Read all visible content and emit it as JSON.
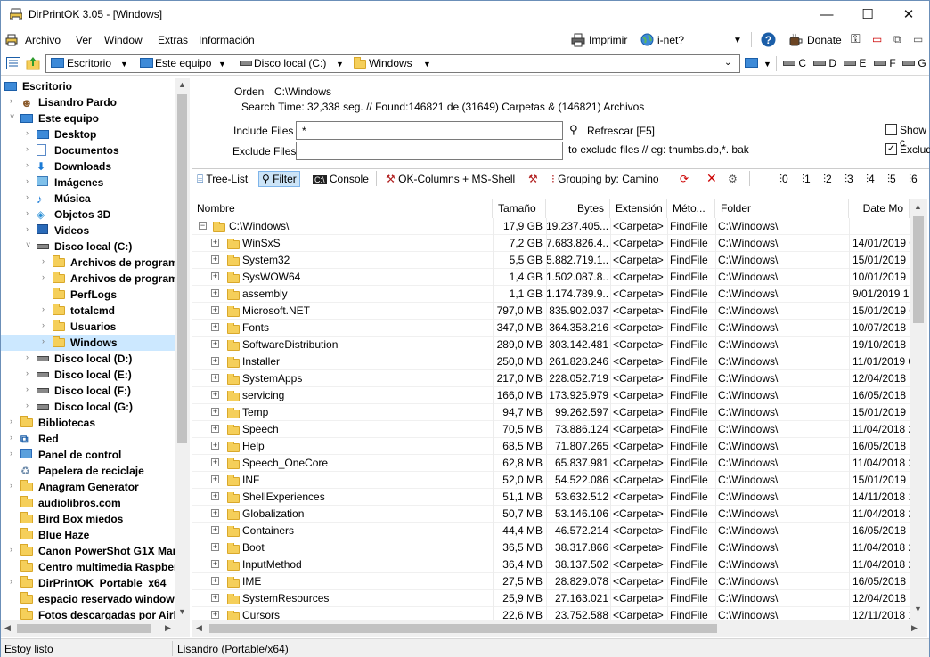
{
  "window": {
    "title": "DirPrintOK 3.05 - [Windows]",
    "minimize": "—",
    "maximize": "☐",
    "close": "✕"
  },
  "menu": {
    "items": [
      "Archivo",
      "Ver",
      "Window",
      "Extras",
      "Información"
    ],
    "print": "Imprimir",
    "inet": "i-net?",
    "donate": "Donate"
  },
  "address": {
    "segments": [
      "Escritorio",
      "Este equipo",
      "Disco local (C:)",
      "Windows"
    ],
    "drives": [
      "C",
      "D",
      "E",
      "F",
      "G"
    ]
  },
  "tree": {
    "items": [
      {
        "label": "Escritorio",
        "indent": 0,
        "icon": "desktop",
        "exp": ""
      },
      {
        "label": "Lisandro Pardo",
        "indent": 1,
        "icon": "user",
        "exp": "›"
      },
      {
        "label": "Este equipo",
        "indent": 1,
        "icon": "pc",
        "exp": "˅"
      },
      {
        "label": "Desktop",
        "indent": 2,
        "icon": "desktop",
        "exp": "›"
      },
      {
        "label": "Documentos",
        "indent": 2,
        "icon": "doc",
        "exp": "›"
      },
      {
        "label": "Downloads",
        "indent": 2,
        "icon": "down",
        "exp": "›"
      },
      {
        "label": "Imágenes",
        "indent": 2,
        "icon": "img",
        "exp": "›"
      },
      {
        "label": "Música",
        "indent": 2,
        "icon": "music",
        "exp": "›"
      },
      {
        "label": "Objetos 3D",
        "indent": 2,
        "icon": "cube",
        "exp": "›"
      },
      {
        "label": "Videos",
        "indent": 2,
        "icon": "video",
        "exp": "›"
      },
      {
        "label": "Disco local (C:)",
        "indent": 2,
        "icon": "drive",
        "exp": "˅"
      },
      {
        "label": "Archivos de program",
        "indent": 3,
        "icon": "folder",
        "exp": "›"
      },
      {
        "label": "Archivos de program",
        "indent": 3,
        "icon": "folder",
        "exp": "›"
      },
      {
        "label": "PerfLogs",
        "indent": 3,
        "icon": "folder",
        "exp": ""
      },
      {
        "label": "totalcmd",
        "indent": 3,
        "icon": "folder",
        "exp": "›"
      },
      {
        "label": "Usuarios",
        "indent": 3,
        "icon": "folder",
        "exp": "›"
      },
      {
        "label": "Windows",
        "indent": 3,
        "icon": "folder",
        "exp": "›",
        "selected": true
      },
      {
        "label": "Disco local (D:)",
        "indent": 2,
        "icon": "drive",
        "exp": "›"
      },
      {
        "label": "Disco local (E:)",
        "indent": 2,
        "icon": "drive",
        "exp": "›"
      },
      {
        "label": "Disco local (F:)",
        "indent": 2,
        "icon": "drive",
        "exp": "›"
      },
      {
        "label": "Disco local (G:)",
        "indent": 2,
        "icon": "drive",
        "exp": "›"
      },
      {
        "label": "Bibliotecas",
        "indent": 1,
        "icon": "folder",
        "exp": "›"
      },
      {
        "label": "Red",
        "indent": 1,
        "icon": "net",
        "exp": "›"
      },
      {
        "label": "Panel de control",
        "indent": 1,
        "icon": "cpanel",
        "exp": "›"
      },
      {
        "label": "Papelera de reciclaje",
        "indent": 1,
        "icon": "bin",
        "exp": ""
      },
      {
        "label": "Anagram Generator",
        "indent": 1,
        "icon": "folder",
        "exp": "›"
      },
      {
        "label": "audiolibros.com",
        "indent": 1,
        "icon": "folder",
        "exp": ""
      },
      {
        "label": "Bird Box miedos",
        "indent": 1,
        "icon": "folder",
        "exp": ""
      },
      {
        "label": "Blue Haze",
        "indent": 1,
        "icon": "folder",
        "exp": ""
      },
      {
        "label": "Canon PowerShot G1X Mar",
        "indent": 1,
        "icon": "folder",
        "exp": "›"
      },
      {
        "label": "Centro multimedia Raspber",
        "indent": 1,
        "icon": "folder",
        "exp": ""
      },
      {
        "label": "DirPrintOK_Portable_x64",
        "indent": 1,
        "icon": "folder",
        "exp": "›"
      },
      {
        "label": "espacio reservado windows",
        "indent": 1,
        "icon": "folder",
        "exp": ""
      },
      {
        "label": "Fotos descargadas por Airl",
        "indent": 1,
        "icon": "folder",
        "exp": ""
      }
    ]
  },
  "info": {
    "orden_label": "Orden",
    "orden_value": "C:\\Windows",
    "search_time": "Search Time: 32,338 seg. //  Found:146821 de (31649) Carpetas & (146821) Archivos",
    "include_label": "Include Files",
    "include_value": "*",
    "refresh": "Refrescar [F5]",
    "exclude_label": "Exclude Files",
    "exclude_value": "",
    "exclude_hint": "to exclude files // eg: thumbs.db,*. bak",
    "show_label": "Show c",
    "exclude_chk_label": "Exclud"
  },
  "toolbar": {
    "tree_list": "Tree-List",
    "filter": "Filter",
    "console": "Console",
    "ok_columns": "OK-Columns + MS-Shell",
    "grouping": "Grouping by: Camino",
    "levels": [
      "0",
      "1",
      "2",
      "3",
      "4",
      "5",
      "6"
    ]
  },
  "table": {
    "headers": [
      "Nombre",
      "Tamaño",
      "Bytes",
      "Extensión",
      "Méto...",
      "Folder",
      "Date Mo"
    ],
    "root": {
      "name": "C:\\Windows\\",
      "size": "17,9 GB",
      "bytes": "19.237.405....",
      "ext": "<Carpeta>",
      "method": "FindFile",
      "folder": "C:\\Windows\\",
      "date": ""
    },
    "rows": [
      {
        "name": "WinSxS",
        "size": "7,2 GB",
        "bytes": "7.683.826.4...",
        "ext": "<Carpeta>",
        "method": "FindFile",
        "folder": "C:\\Windows\\",
        "date": "14/01/2019 0"
      },
      {
        "name": "System32",
        "size": "5,5 GB",
        "bytes": "5.882.719.1...",
        "ext": "<Carpeta>",
        "method": "FindFile",
        "folder": "C:\\Windows\\",
        "date": "15/01/2019 1"
      },
      {
        "name": "SysWOW64",
        "size": "1,4 GB",
        "bytes": "1.502.087.8...",
        "ext": "<Carpeta>",
        "method": "FindFile",
        "folder": "C:\\Windows\\",
        "date": "10/01/2019 2"
      },
      {
        "name": "assembly",
        "size": "1,1 GB",
        "bytes": "1.174.789.9...",
        "ext": "<Carpeta>",
        "method": "FindFile",
        "folder": "C:\\Windows\\",
        "date": "9/01/2019 1"
      },
      {
        "name": "Microsoft.NET",
        "size": "797,0 MB",
        "bytes": "835.902.037",
        "ext": "<Carpeta>",
        "method": "FindFile",
        "folder": "C:\\Windows\\",
        "date": "15/01/2019 0"
      },
      {
        "name": "Fonts",
        "size": "347,0 MB",
        "bytes": "364.358.216",
        "ext": "<Carpeta>",
        "method": "FindFile",
        "folder": "C:\\Windows\\",
        "date": "10/07/2018 2"
      },
      {
        "name": "SoftwareDistribution",
        "size": "289,0 MB",
        "bytes": "303.142.481",
        "ext": "<Carpeta>",
        "method": "FindFile",
        "folder": "C:\\Windows\\",
        "date": "19/10/2018 2"
      },
      {
        "name": "Installer",
        "size": "250,0 MB",
        "bytes": "261.828.246",
        "ext": "<Carpeta>",
        "method": "FindFile",
        "folder": "C:\\Windows\\",
        "date": "11/01/2019 0"
      },
      {
        "name": "SystemApps",
        "size": "217,0 MB",
        "bytes": "228.052.719",
        "ext": "<Carpeta>",
        "method": "FindFile",
        "folder": "C:\\Windows\\",
        "date": "12/04/2018 1"
      },
      {
        "name": "servicing",
        "size": "166,0 MB",
        "bytes": "173.925.979",
        "ext": "<Carpeta>",
        "method": "FindFile",
        "folder": "C:\\Windows\\",
        "date": "16/05/2018 1"
      },
      {
        "name": "Temp",
        "size": "94,7 MB",
        "bytes": "99.262.597",
        "ext": "<Carpeta>",
        "method": "FindFile",
        "folder": "C:\\Windows\\",
        "date": "15/01/2019 1"
      },
      {
        "name": "Speech",
        "size": "70,5 MB",
        "bytes": "73.886.124",
        "ext": "<Carpeta>",
        "method": "FindFile",
        "folder": "C:\\Windows\\",
        "date": "11/04/2018 2"
      },
      {
        "name": "Help",
        "size": "68,5 MB",
        "bytes": "71.807.265",
        "ext": "<Carpeta>",
        "method": "FindFile",
        "folder": "C:\\Windows\\",
        "date": "16/05/2018 2"
      },
      {
        "name": "Speech_OneCore",
        "size": "62,8 MB",
        "bytes": "65.837.981",
        "ext": "<Carpeta>",
        "method": "FindFile",
        "folder": "C:\\Windows\\",
        "date": "11/04/2018 2"
      },
      {
        "name": "INF",
        "size": "52,0 MB",
        "bytes": "54.522.086",
        "ext": "<Carpeta>",
        "method": "FindFile",
        "folder": "C:\\Windows\\",
        "date": "15/01/2019 1"
      },
      {
        "name": "ShellExperiences",
        "size": "51,1 MB",
        "bytes": "53.632.512",
        "ext": "<Carpeta>",
        "method": "FindFile",
        "folder": "C:\\Windows\\",
        "date": "14/11/2018 1"
      },
      {
        "name": "Globalization",
        "size": "50,7 MB",
        "bytes": "53.146.106",
        "ext": "<Carpeta>",
        "method": "FindFile",
        "folder": "C:\\Windows\\",
        "date": "11/04/2018 2"
      },
      {
        "name": "Containers",
        "size": "44,4 MB",
        "bytes": "46.572.214",
        "ext": "<Carpeta>",
        "method": "FindFile",
        "folder": "C:\\Windows\\",
        "date": "16/05/2018 1"
      },
      {
        "name": "Boot",
        "size": "36,5 MB",
        "bytes": "38.317.866",
        "ext": "<Carpeta>",
        "method": "FindFile",
        "folder": "C:\\Windows\\",
        "date": "11/04/2018 2"
      },
      {
        "name": "InputMethod",
        "size": "36,4 MB",
        "bytes": "38.137.502",
        "ext": "<Carpeta>",
        "method": "FindFile",
        "folder": "C:\\Windows\\",
        "date": "11/04/2018 2"
      },
      {
        "name": "IME",
        "size": "27,5 MB",
        "bytes": "28.829.078",
        "ext": "<Carpeta>",
        "method": "FindFile",
        "folder": "C:\\Windows\\",
        "date": "16/05/2018 1"
      },
      {
        "name": "SystemResources",
        "size": "25,9 MB",
        "bytes": "27.163.021",
        "ext": "<Carpeta>",
        "method": "FindFile",
        "folder": "C:\\Windows\\",
        "date": "12/04/2018 1"
      },
      {
        "name": "Cursors",
        "size": "22,6 MB",
        "bytes": "23.752.588",
        "ext": "<Carpeta>",
        "method": "FindFile",
        "folder": "C:\\Windows\\",
        "date": "12/11/2018 1"
      }
    ]
  },
  "status": {
    "left": "Estoy listo",
    "right": "Lisandro (Portable/x64)"
  }
}
